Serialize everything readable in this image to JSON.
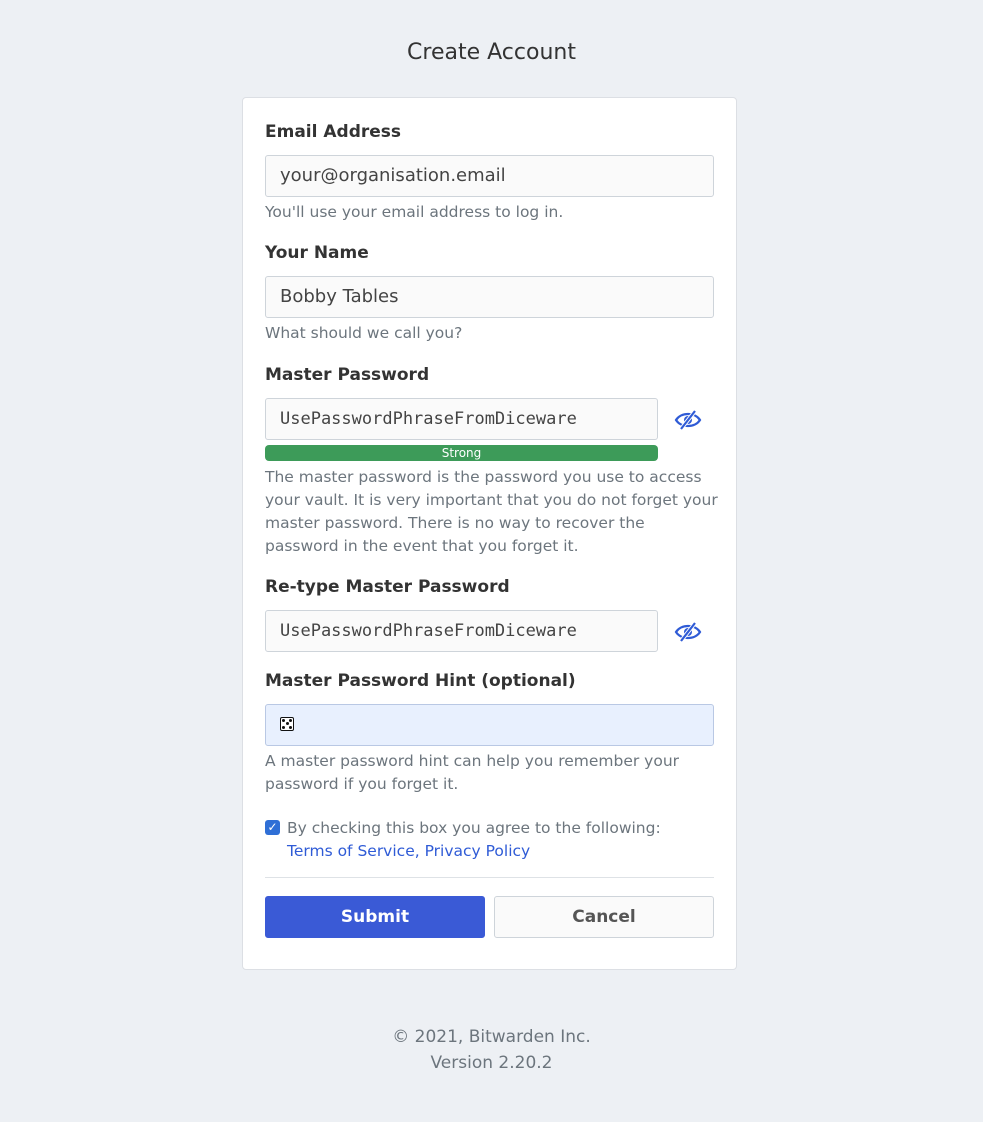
{
  "page": {
    "title": "Create Account"
  },
  "form": {
    "email": {
      "label": "Email Address",
      "value": "your@organisation.email",
      "help": "You'll use your email address to log in."
    },
    "name": {
      "label": "Your Name",
      "value": "Bobby Tables",
      "help": "What should we call you?"
    },
    "master_password": {
      "label": "Master Password",
      "value": "UsePasswordPhraseFromDiceware",
      "strength": "Strong",
      "strength_color": "#3d9b59",
      "help": "The master password is the password you use to access your vault. It is very important that you do not forget your master password. There is no way to recover the password in the event that you forget it.",
      "toggle_icon": "eye-slash-icon"
    },
    "retype_password": {
      "label": "Re-type Master Password",
      "value": "UsePasswordPhraseFromDiceware",
      "toggle_icon": "eye-slash-icon"
    },
    "hint": {
      "label": "Master Password Hint (optional)",
      "value": "",
      "autofill_icon": "dice-icon",
      "help": "A master password hint can help you remember your password if you forget it."
    },
    "terms": {
      "checked": true,
      "text": "By checking this box you agree to the following:",
      "terms_link": "Terms of Service,",
      "privacy_link": "Privacy Policy"
    },
    "submit_label": "Submit",
    "cancel_label": "Cancel"
  },
  "footer": {
    "copyright": "© 2021, Bitwarden Inc.",
    "version": "Version 2.20.2"
  },
  "colors": {
    "accent": "#3a5ad6",
    "link": "#2f5bd6",
    "background": "#edf0f4"
  }
}
